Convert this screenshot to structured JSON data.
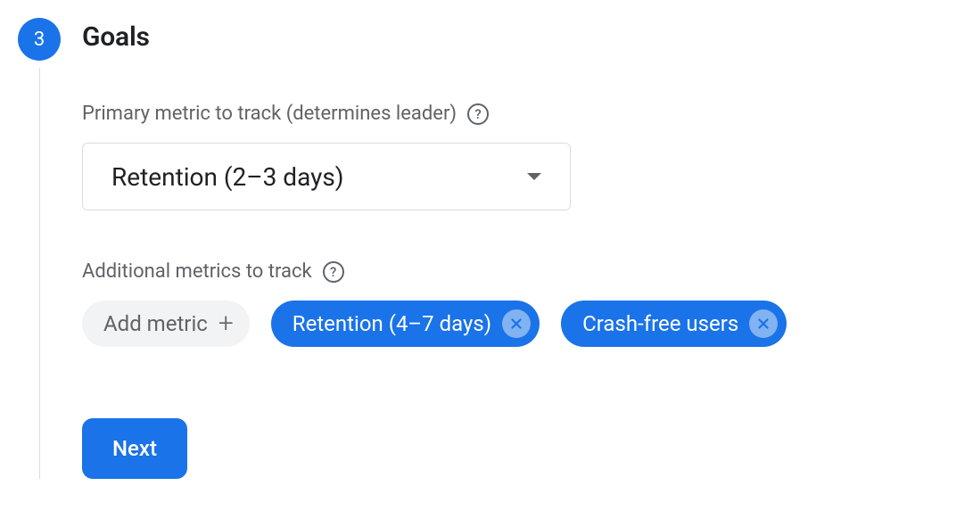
{
  "step": {
    "number": "3",
    "title": "Goals"
  },
  "primary": {
    "label": "Primary metric to track (determines leader)",
    "selected": "Retention (2–3 days)"
  },
  "additional": {
    "label": "Additional metrics to track",
    "add_label": "Add metric",
    "chips": [
      {
        "label": "Retention (4–7 days)"
      },
      {
        "label": "Crash-free users"
      }
    ]
  },
  "actions": {
    "next": "Next"
  }
}
